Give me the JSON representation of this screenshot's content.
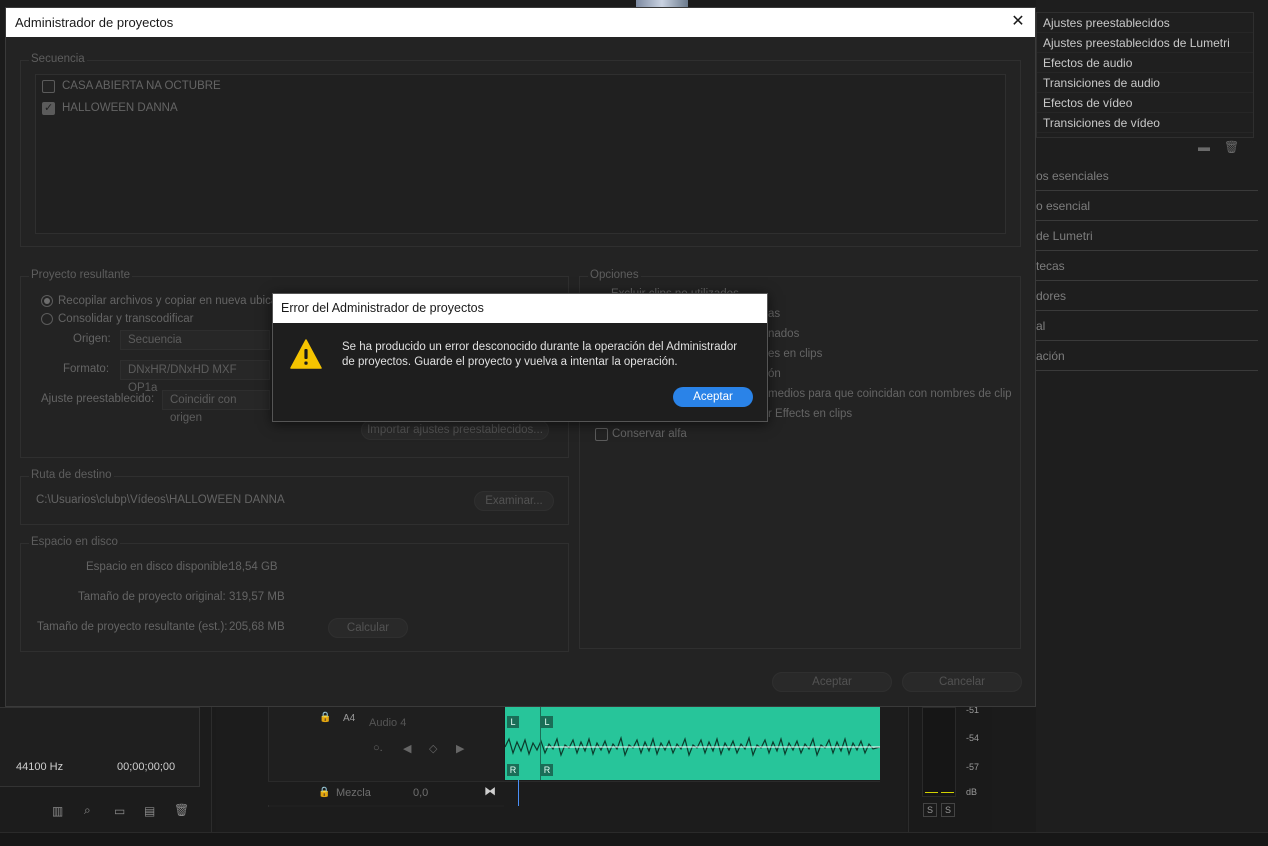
{
  "background": {
    "effects_list": [
      "Ajustes preestablecidos",
      "Ajustes preestablecidos de Lumetri",
      "Efectos de audio",
      "Transiciones de audio",
      "Efectos de vídeo",
      "Transiciones de vídeo"
    ],
    "side_sections": [
      "os esenciales",
      "o esencial",
      "de Lumetri",
      "tecas",
      "dores",
      "al",
      "ación"
    ],
    "bottom_left": {
      "sample_rate": "44100 Hz",
      "timecode": "00;00;00;00"
    },
    "track": {
      "id": "A4",
      "name": "Audio 4",
      "left_badge": "L",
      "right_badge": "R"
    },
    "mix": {
      "label": "Mezcla",
      "value": "0,0"
    },
    "meter": {
      "ticks": [
        "-51",
        "-54",
        "-57",
        "dB"
      ],
      "solo": [
        "S",
        "S"
      ]
    }
  },
  "project_manager": {
    "title": "Administrador de proyectos",
    "sequence_group": "Secuencia",
    "sequences": [
      {
        "name": "CASA ABIERTA NA OCTUBRE",
        "checked": false
      },
      {
        "name": "HALLOWEEN DANNA",
        "checked": true
      }
    ],
    "result_group": "Proyecto resultante",
    "radio_copy": "Recopilar archivos y copiar en nueva ubicac",
    "radio_consolidate": "Consolidar y transcodificar",
    "origin_label": "Origen:",
    "origin_value": "Secuencia",
    "format_label": "Formato:",
    "format_value": "DNxHR/DNxHD MXF OP1a",
    "preset_label": "Ajuste preestablecido:",
    "preset_value": "Coincidir con origen",
    "import_presets_button": "Importar ajustes preestablecidos...",
    "options_group": "Opciones",
    "options": [
      "Excluir clips no utilizados",
      "as",
      "nados",
      "es en clips",
      "ón",
      "medios para que coincidan con nombres de clip",
      "r Effects en clips",
      "Conservar alfa"
    ],
    "dest_group": "Ruta de destino",
    "dest_path": "C:\\Usuarios\\clubp\\Vídeos\\HALLOWEEN DANNA",
    "browse_button": "Examinar...",
    "disk_group": "Espacio en disco",
    "disk_available_label": "Espacio en disco disponible:",
    "disk_available_value": "18,54 GB",
    "orig_size_label": "Tamaño de proyecto original:",
    "orig_size_value": "319,57 MB",
    "result_size_label": "Tamaño de proyecto resultante (est.):",
    "result_size_value": "205,68 MB",
    "calc_button": "Calcular",
    "ok_button": "Aceptar",
    "cancel_button": "Cancelar"
  },
  "error_dialog": {
    "title": "Error del Administrador de proyectos",
    "message": "Se ha producido un error desconocido durante la operación del Administrador de proyectos. Guarde el proyecto y vuelva a intentar la operación.",
    "ok_button": "Aceptar",
    "accent_color": "#2a83e8",
    "warning_color": "#f5c400"
  }
}
